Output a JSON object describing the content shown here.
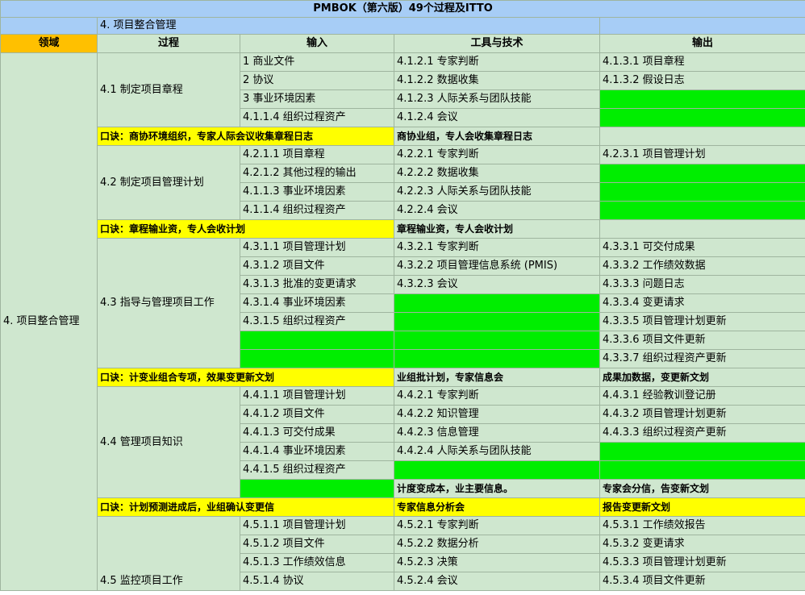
{
  "title": "PMBOK（第六版）49个过程及ITTO",
  "section": "4. 项目整合管理",
  "headers": {
    "domain": "领域",
    "process": "过程",
    "input": "输入",
    "tools": "工具与技术",
    "output": "输出"
  },
  "domain_cell": "4. 项目整合管理",
  "processes": [
    {
      "name": "4.1 制定项目章程",
      "inputs": [
        "1 商业文件",
        "2 协议",
        "3 事业环境因素",
        "4.1.1.4 组织过程资产"
      ],
      "tools": [
        "4.1.2.1 专家判断",
        "4.1.2.2 数据收集",
        "4.1.2.3 人际关系与团队技能",
        "4.1.2.4 会议"
      ],
      "outputs": [
        "4.1.3.1 项目章程",
        "4.1.3.2 假设日志",
        "",
        ""
      ],
      "mnemonic": "口诀：商协环境组织，专家人际会议收集章程日志",
      "mnemonic_tools": "商协业组，专人会收集章程日志",
      "mnemonic_output": ""
    },
    {
      "name": "4.2 制定项目管理计划",
      "inputs": [
        "4.2.1.1 项目章程",
        "4.2.1.2 其他过程的输出",
        "4.1.1.3 事业环境因素",
        "4.1.1.4 组织过程资产"
      ],
      "tools": [
        "4.2.2.1 专家判断",
        "4.2.2.2 数据收集",
        "4.2.2.3 人际关系与团队技能",
        "4.2.2.4 会议"
      ],
      "outputs": [
        "4.2.3.1 项目管理计划",
        "",
        "",
        ""
      ],
      "mnemonic": "口诀：章程输业资，专人会收计划",
      "mnemonic_tools": "章程输业资，专人会收计划",
      "mnemonic_output": ""
    },
    {
      "name": "4.3 指导与管理项目工作",
      "inputs": [
        "4.3.1.1 项目管理计划",
        "4.3.1.2 项目文件",
        "4.3.1.3 批准的变更请求",
        "4.3.1.4 事业环境因素",
        "4.3.1.5 组织过程资产",
        "",
        ""
      ],
      "tools": [
        "4.3.2.1 专家判断",
        "4.3.2.2 项目管理信息系统 (PMIS)",
        "4.3.2.3 会议",
        "",
        "",
        "",
        ""
      ],
      "outputs": [
        "4.3.3.1 可交付成果",
        "4.3.3.2 工作绩效数据",
        "4.3.3.3 问题日志",
        "4.3.3.4 变更请求",
        "4.3.3.5 项目管理计划更新",
        "4.3.3.6 项目文件更新",
        "4.3.3.7 组织过程资产更新"
      ],
      "mnemonic": "口诀：计变业组合专项，效果变更新文划",
      "mnemonic_tools": "业组批计划，专家信息会",
      "mnemonic_output": "成果加数据，变更新文划"
    },
    {
      "name": "4.4 管理项目知识",
      "inputs": [
        "4.4.1.1 项目管理计划",
        "4.4.1.2 项目文件",
        "4.4.1.3 可交付成果",
        "4.4.1.4 事业环境因素",
        "4.4.1.5 组织过程资产",
        ""
      ],
      "tools": [
        "4.4.2.1 专家判断",
        "4.4.2.2 知识管理",
        "4.4.2.3 信息管理",
        "4.4.2.4 人际关系与团队技能",
        "",
        "计度变成本，业主要信息。"
      ],
      "outputs": [
        "4.4.3.1 经验教训登记册",
        "4.4.3.2 项目管理计划更新",
        "4.4.3.3 组织过程资产更新",
        "",
        "",
        "专家会分信，告变新文划"
      ],
      "mnemonic": "口诀：计划预测进成后，业组确认变更信",
      "mnemonic_tools": "专家信息分析会",
      "mnemonic_output": "报告变更新文划"
    },
    {
      "name": "4.5 监控项目工作",
      "inputs": [
        "4.5.1.1 项目管理计划",
        "4.5.1.2 项目文件",
        "4.5.1.3 工作绩效信息",
        "4.5.1.4 协议"
      ],
      "tools": [
        "4.5.2.1 专家判断",
        "4.5.2.2 数据分析",
        "4.5.2.3 决策",
        "4.5.2.4 会议"
      ],
      "outputs": [
        "4.5.3.1 工作绩效报告",
        "4.5.3.2 变更请求",
        "4.5.3.3 项目管理计划更新",
        "4.5.3.4 项目文件更新"
      ]
    }
  ]
}
